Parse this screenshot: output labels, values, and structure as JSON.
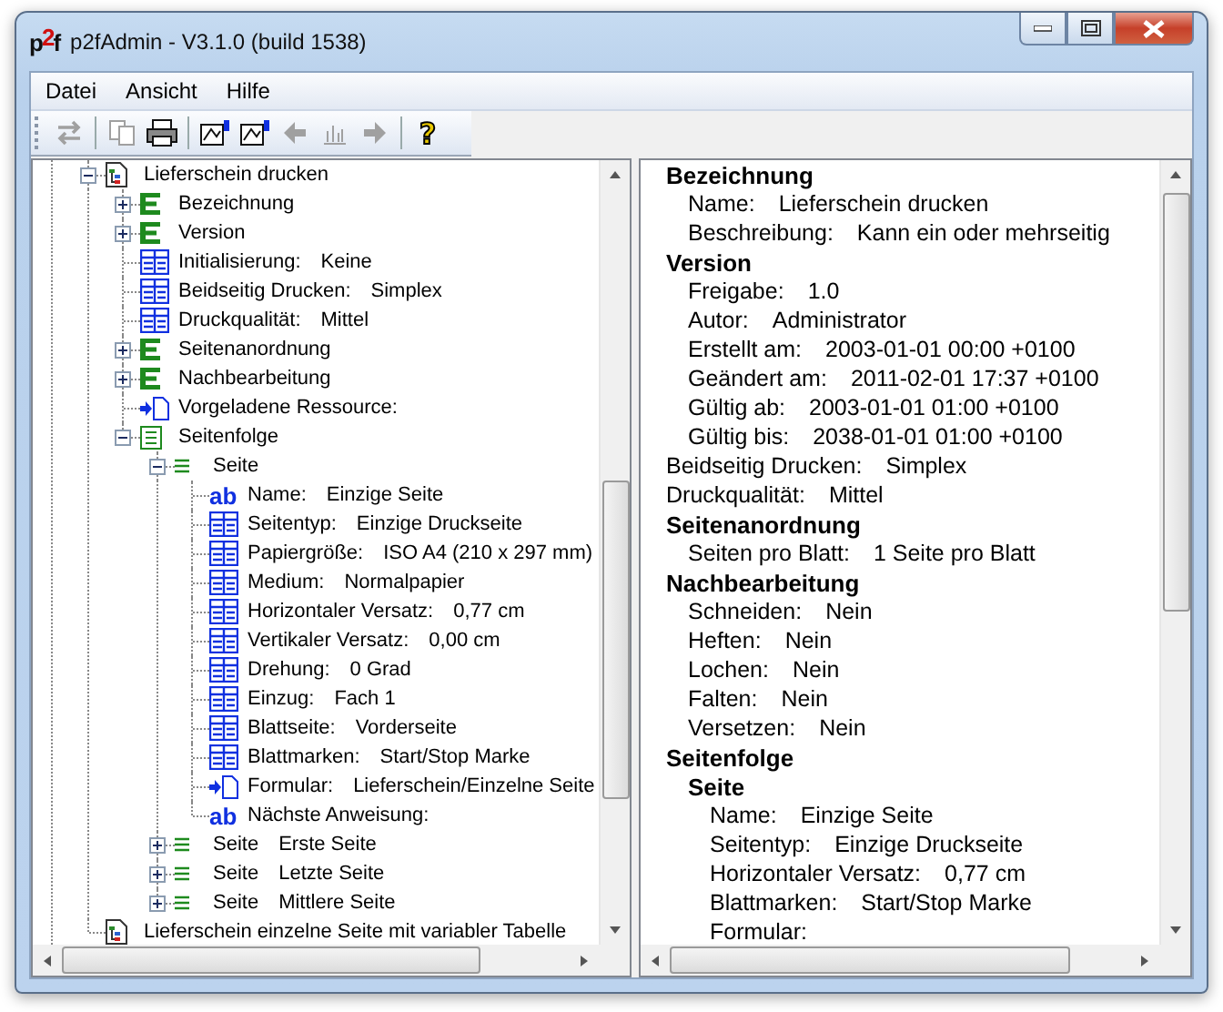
{
  "window": {
    "logo": "p2f",
    "title": "p2fAdmin - V3.1.0 (build 1538)"
  },
  "menu": [
    "Datei",
    "Ansicht",
    "Hilfe"
  ],
  "toolbar": [
    {
      "kind": "swap",
      "disabled": true
    },
    {
      "kind": "separator"
    },
    {
      "kind": "copy",
      "disabled": true
    },
    {
      "kind": "print",
      "disabled": false
    },
    {
      "kind": "separator"
    },
    {
      "kind": "export",
      "disabled": false
    },
    {
      "kind": "import",
      "disabled": false
    },
    {
      "kind": "back",
      "disabled": true
    },
    {
      "kind": "chart",
      "disabled": true
    },
    {
      "kind": "forward",
      "disabled": true
    },
    {
      "kind": "separator"
    },
    {
      "kind": "help",
      "glyph": "?",
      "disabled": false
    }
  ],
  "tree": [
    {
      "kind": "document",
      "label": "Lieferschein drucken",
      "expanded": true,
      "children": [
        {
          "kind": "element",
          "label": "Bezeichnung",
          "expanded": false
        },
        {
          "kind": "element",
          "label": "Version",
          "expanded": false
        },
        {
          "kind": "property",
          "label": "Initialisierung:",
          "value": "Keine"
        },
        {
          "kind": "property",
          "label": "Beidseitig Drucken:",
          "value": "Simplex"
        },
        {
          "kind": "property",
          "label": "Druckqualität:",
          "value": "Mittel"
        },
        {
          "kind": "element",
          "label": "Seitenanordnung",
          "expanded": false
        },
        {
          "kind": "element",
          "label": "Nachbearbeitung",
          "expanded": false
        },
        {
          "kind": "reference",
          "label": "Vorgeladene Ressource:"
        },
        {
          "kind": "list",
          "label": "Seitenfolge",
          "expanded": true,
          "children": [
            {
              "kind": "lines",
              "label": "Seite",
              "expanded": true,
              "children": [
                {
                  "kind": "text",
                  "badge": "ab",
                  "label": "Name:",
                  "value": "Einzige Seite"
                },
                {
                  "kind": "property",
                  "label": "Seitentyp:",
                  "value": "Einzige Druckseite"
                },
                {
                  "kind": "property",
                  "label": "Papiergröße:",
                  "value": "ISO A4 (210 x 297 mm)"
                },
                {
                  "kind": "property",
                  "label": "Medium:",
                  "value": "Normalpapier"
                },
                {
                  "kind": "property",
                  "label": "Horizontaler Versatz:",
                  "value": "0,77 cm"
                },
                {
                  "kind": "property",
                  "label": "Vertikaler Versatz:",
                  "value": "0,00 cm"
                },
                {
                  "kind": "property",
                  "label": "Drehung:",
                  "value": "0 Grad"
                },
                {
                  "kind": "property",
                  "label": "Einzug:",
                  "value": "Fach 1"
                },
                {
                  "kind": "property",
                  "label": "Blattseite:",
                  "value": "Vorderseite"
                },
                {
                  "kind": "property",
                  "label": "Blattmarken:",
                  "value": "Start/Stop Marke"
                },
                {
                  "kind": "reference",
                  "label": "Formular:",
                  "value": "Lieferschein/Einzelne Seite"
                },
                {
                  "kind": "text",
                  "badge": "ab",
                  "label": "Nächste Anweisung:"
                }
              ]
            },
            {
              "kind": "lines",
              "label": "Seite",
              "value": "Erste Seite",
              "expanded": false
            },
            {
              "kind": "lines",
              "label": "Seite",
              "value": "Letzte Seite",
              "expanded": false
            },
            {
              "kind": "lines",
              "label": "Seite",
              "value": "Mittlere Seite",
              "expanded": false
            }
          ]
        }
      ]
    },
    {
      "kind": "document",
      "label": "Lieferschein einzelne Seite mit variabler Tabelle"
    }
  ],
  "details": [
    {
      "kind": "section",
      "title": "Bezeichnung",
      "items": [
        {
          "kind": "field",
          "label": "Name:",
          "value": "Lieferschein drucken"
        },
        {
          "kind": "field",
          "label": "Beschreibung:",
          "value": "Kann ein oder mehrseitig"
        }
      ]
    },
    {
      "kind": "section",
      "title": "Version",
      "items": [
        {
          "kind": "field",
          "label": "Freigabe:",
          "value": "1.0"
        },
        {
          "kind": "field",
          "label": "Autor:",
          "value": "Administrator"
        },
        {
          "kind": "field",
          "label": "Erstellt am:",
          "value": "2003-01-01 00:00 +0100"
        },
        {
          "kind": "field",
          "label": "Geändert am:",
          "value": "2011-02-01 17:37 +0100"
        },
        {
          "kind": "field",
          "label": "Gültig ab:",
          "value": "2003-01-01 01:00 +0100"
        },
        {
          "kind": "field",
          "label": "Gültig bis:",
          "value": "2038-01-01 01:00 +0100"
        }
      ]
    },
    {
      "kind": "field",
      "label": "Beidseitig Drucken:",
      "value": "Simplex"
    },
    {
      "kind": "field",
      "label": "Druckqualität:",
      "value": "Mittel"
    },
    {
      "kind": "section",
      "title": "Seitenanordnung",
      "items": [
        {
          "kind": "field",
          "label": "Seiten pro Blatt:",
          "value": "1 Seite pro Blatt"
        }
      ]
    },
    {
      "kind": "section",
      "title": "Nachbearbeitung",
      "items": [
        {
          "kind": "field",
          "label": "Schneiden:",
          "value": "Nein"
        },
        {
          "kind": "field",
          "label": "Heften:",
          "value": "Nein"
        },
        {
          "kind": "field",
          "label": "Lochen:",
          "value": "Nein"
        },
        {
          "kind": "field",
          "label": "Falten:",
          "value": "Nein"
        },
        {
          "kind": "field",
          "label": "Versetzen:",
          "value": "Nein"
        }
      ]
    },
    {
      "kind": "section",
      "title": "Seitenfolge",
      "items": [
        {
          "kind": "section",
          "title": "Seite",
          "items": [
            {
              "kind": "field",
              "label": "Name:",
              "value": "Einzige Seite"
            },
            {
              "kind": "field",
              "label": "Seitentyp:",
              "value": "Einzige Druckseite"
            },
            {
              "kind": "field",
              "label": "Horizontaler Versatz:",
              "value": "0,77 cm"
            },
            {
              "kind": "field",
              "label": "Blattmarken:",
              "value": "Start/Stop Marke"
            },
            {
              "kind": "field",
              "label": "Formular:"
            }
          ]
        }
      ]
    }
  ]
}
